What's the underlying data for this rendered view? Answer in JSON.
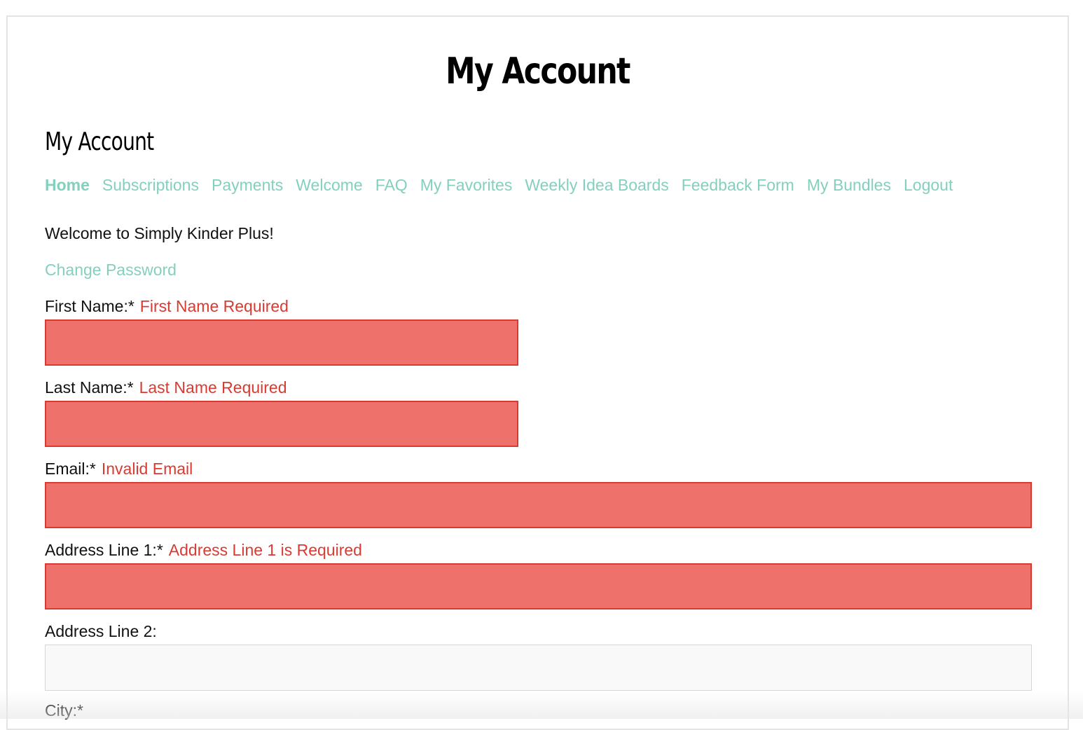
{
  "page": {
    "title": "My Account"
  },
  "section": {
    "title": "My Account"
  },
  "nav": {
    "items": [
      {
        "label": "Home",
        "active": true
      },
      {
        "label": "Subscriptions"
      },
      {
        "label": "Payments"
      },
      {
        "label": "Welcome"
      },
      {
        "label": "FAQ"
      },
      {
        "label": "My Favorites"
      },
      {
        "label": "Weekly Idea Boards"
      },
      {
        "label": "Feedback Form"
      },
      {
        "label": "My Bundles"
      },
      {
        "label": "Logout"
      }
    ]
  },
  "welcome_text": "Welcome to Simply Kinder Plus!",
  "change_password_link": "Change Password",
  "form": {
    "first_name": {
      "label": "First Name:*",
      "error": "First Name Required",
      "value": ""
    },
    "last_name": {
      "label": "Last Name:*",
      "error": "Last Name Required",
      "value": ""
    },
    "email": {
      "label": "Email:*",
      "error": "Invalid Email",
      "value": ""
    },
    "address_line_1": {
      "label": "Address Line 1:*",
      "error": "Address Line 1 is Required",
      "value": ""
    },
    "address_line_2": {
      "label": "Address Line 2:",
      "value": ""
    },
    "city": {
      "label": "City:*"
    }
  },
  "colors": {
    "link": "#84cfbe",
    "error_text": "#d93a32",
    "error_field_bg": "#ee716b",
    "error_field_border": "#d93a32",
    "normal_field_bg": "#f9f9f9"
  }
}
